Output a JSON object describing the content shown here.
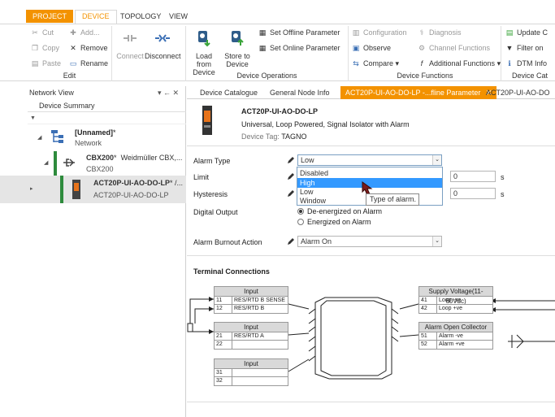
{
  "ribbon_tabs": [
    "PROJECT",
    "DEVICE",
    "TOPOLOGY",
    "VIEW"
  ],
  "ribbon": {
    "edit": {
      "cut": "Cut",
      "copy": "Copy",
      "paste": "Paste",
      "add": "Add...",
      "remove": "Remove",
      "rename": "Rename",
      "group_label": "Edit"
    },
    "connect": {
      "connect": "Connect",
      "disconnect": "Disconnect"
    },
    "device_operations": {
      "load": "Load from Device",
      "store": "Store to Device",
      "set_offline": "Set Offline Parameter",
      "set_online": "Set Online Parameter",
      "group_label": "Device Operations"
    },
    "device_functions": {
      "configuration": "Configuration",
      "diagnosis": "Diagnosis",
      "observe": "Observe",
      "channel_functions": "Channel Functions",
      "compare": "Compare",
      "additional_functions": "Additional Functions",
      "group_label": "Device Functions"
    },
    "device_catalogue": {
      "update": "Update C",
      "filter": "Filter on",
      "dtm_info": "DTM Info",
      "group_label": "Device Cat"
    }
  },
  "network_view": {
    "title": "Network View",
    "pin": "▾ ← ✕",
    "summary": "Device Summary",
    "filter_icon": "▼",
    "nodes": [
      {
        "name": "[Unnamed]",
        "mark": "*",
        "sub": "Network"
      },
      {
        "name": "CBX200",
        "mark": "*",
        "extra": "Weidmüller CBX,...",
        "sub": "CBX200"
      },
      {
        "name": "ACT20P-UI-AO-DO-LP",
        "mark": "* /...",
        "sub": "ACT20P-UI-AO-DO-LP"
      }
    ]
  },
  "doc_tabs": [
    "Device Catalogue",
    "General Node Info",
    "ACT20P-UI-AO-DO-LP -...fline Parameter",
    "ACT20P-UI-AO-DO"
  ],
  "doc_tab_close": "✕",
  "device": {
    "title": "ACT20P-UI-AO-DO-LP",
    "description": "Universal, Loop Powered, Signal Isolator with Alarm",
    "tag_label": "Device Tag:",
    "tag_value": "TAGNO"
  },
  "params": {
    "alarm_type_label": "Alarm Type",
    "alarm_type_value": "Low",
    "dropdown_options": [
      "Disabled",
      "High",
      "Low",
      "Window"
    ],
    "tooltip": "Type of alarm.",
    "limit_label": "Limit",
    "limit_value": "0",
    "limit_unit": "s",
    "hysteresis_label": "Hysteresis",
    "hysteresis_value": "0",
    "hysteresis_unit": "s",
    "digital_output_label": "Digital Output",
    "digital_output_options": [
      "De-energized on Alarm",
      "Energized on Alarm"
    ],
    "burnout_label": "Alarm Burnout Action",
    "burnout_value": "Alarm On"
  },
  "terminal": {
    "title": "Terminal Connections",
    "input1": {
      "header": "Input",
      "rows": [
        [
          "11",
          "RES/RTD B SENSE"
        ],
        [
          "12",
          "RES/RTD B"
        ]
      ]
    },
    "input2": {
      "header": "Input",
      "rows": [
        [
          "21",
          "RES/RTD A"
        ],
        [
          "22",
          ""
        ]
      ]
    },
    "input3": {
      "header": "Input",
      "rows": [
        [
          "31",
          ""
        ],
        [
          "32",
          ""
        ]
      ]
    },
    "supply": {
      "header": "Supply Voltage(11-60Vdc)",
      "rows": [
        [
          "41",
          "Loop -ve"
        ],
        [
          "42",
          "Loop +ve"
        ]
      ]
    },
    "alarm": {
      "header": "Alarm Open Collector",
      "rows": [
        [
          "51",
          "Alarm -ve"
        ],
        [
          "52",
          "Alarm +ve"
        ]
      ]
    }
  },
  "colors": {
    "accent": "#f39200",
    "selection": "#3399ff",
    "tree_bar": "#2e8b3d"
  }
}
